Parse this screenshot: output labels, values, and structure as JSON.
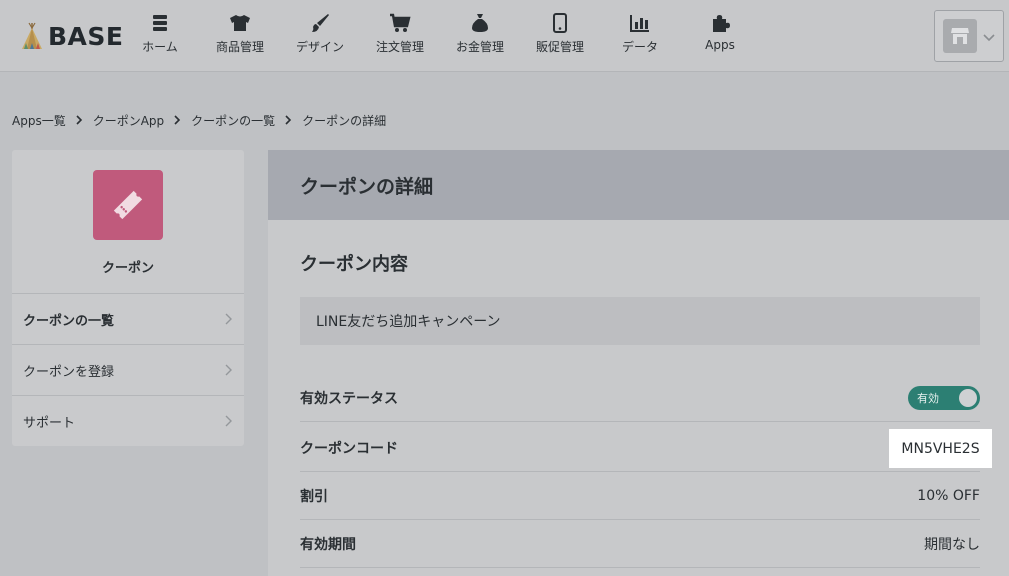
{
  "brand": {
    "name": "BASE"
  },
  "nav": [
    {
      "label": "ホーム",
      "icon": "home-icon"
    },
    {
      "label": "商品管理",
      "icon": "shirt-icon"
    },
    {
      "label": "デザイン",
      "icon": "brush-icon"
    },
    {
      "label": "注文管理",
      "icon": "cart-icon"
    },
    {
      "label": "お金管理",
      "icon": "money-bag-icon"
    },
    {
      "label": "販促管理",
      "icon": "phone-icon"
    },
    {
      "label": "データ",
      "icon": "bar-chart-icon"
    },
    {
      "label": "Apps",
      "icon": "puzzle-icon"
    }
  ],
  "breadcrumb": [
    "Apps一覧",
    "クーポンApp",
    "クーポンの一覧",
    "クーポンの詳細"
  ],
  "sidebar": {
    "app_name": "クーポン",
    "items": [
      {
        "label": "クーポンの一覧"
      },
      {
        "label": "クーポンを登録"
      },
      {
        "label": "サポート"
      }
    ]
  },
  "main": {
    "title": "クーポンの詳細",
    "section_title": "クーポン内容",
    "campaign_name": "LINE友だち追加キャンペーン",
    "status_label": "有効ステータス",
    "status_toggle": "有効",
    "code_label": "クーポンコード",
    "code_value": "MN5VHE2S",
    "discount_label": "割引",
    "discount_value": "10% OFF",
    "period_label": "有効期間",
    "period_value": "期間なし"
  },
  "colors": {
    "toggle_on": "#2c7f73",
    "app_icon": "#c05a7c",
    "page_header": "#a6a9b0"
  }
}
